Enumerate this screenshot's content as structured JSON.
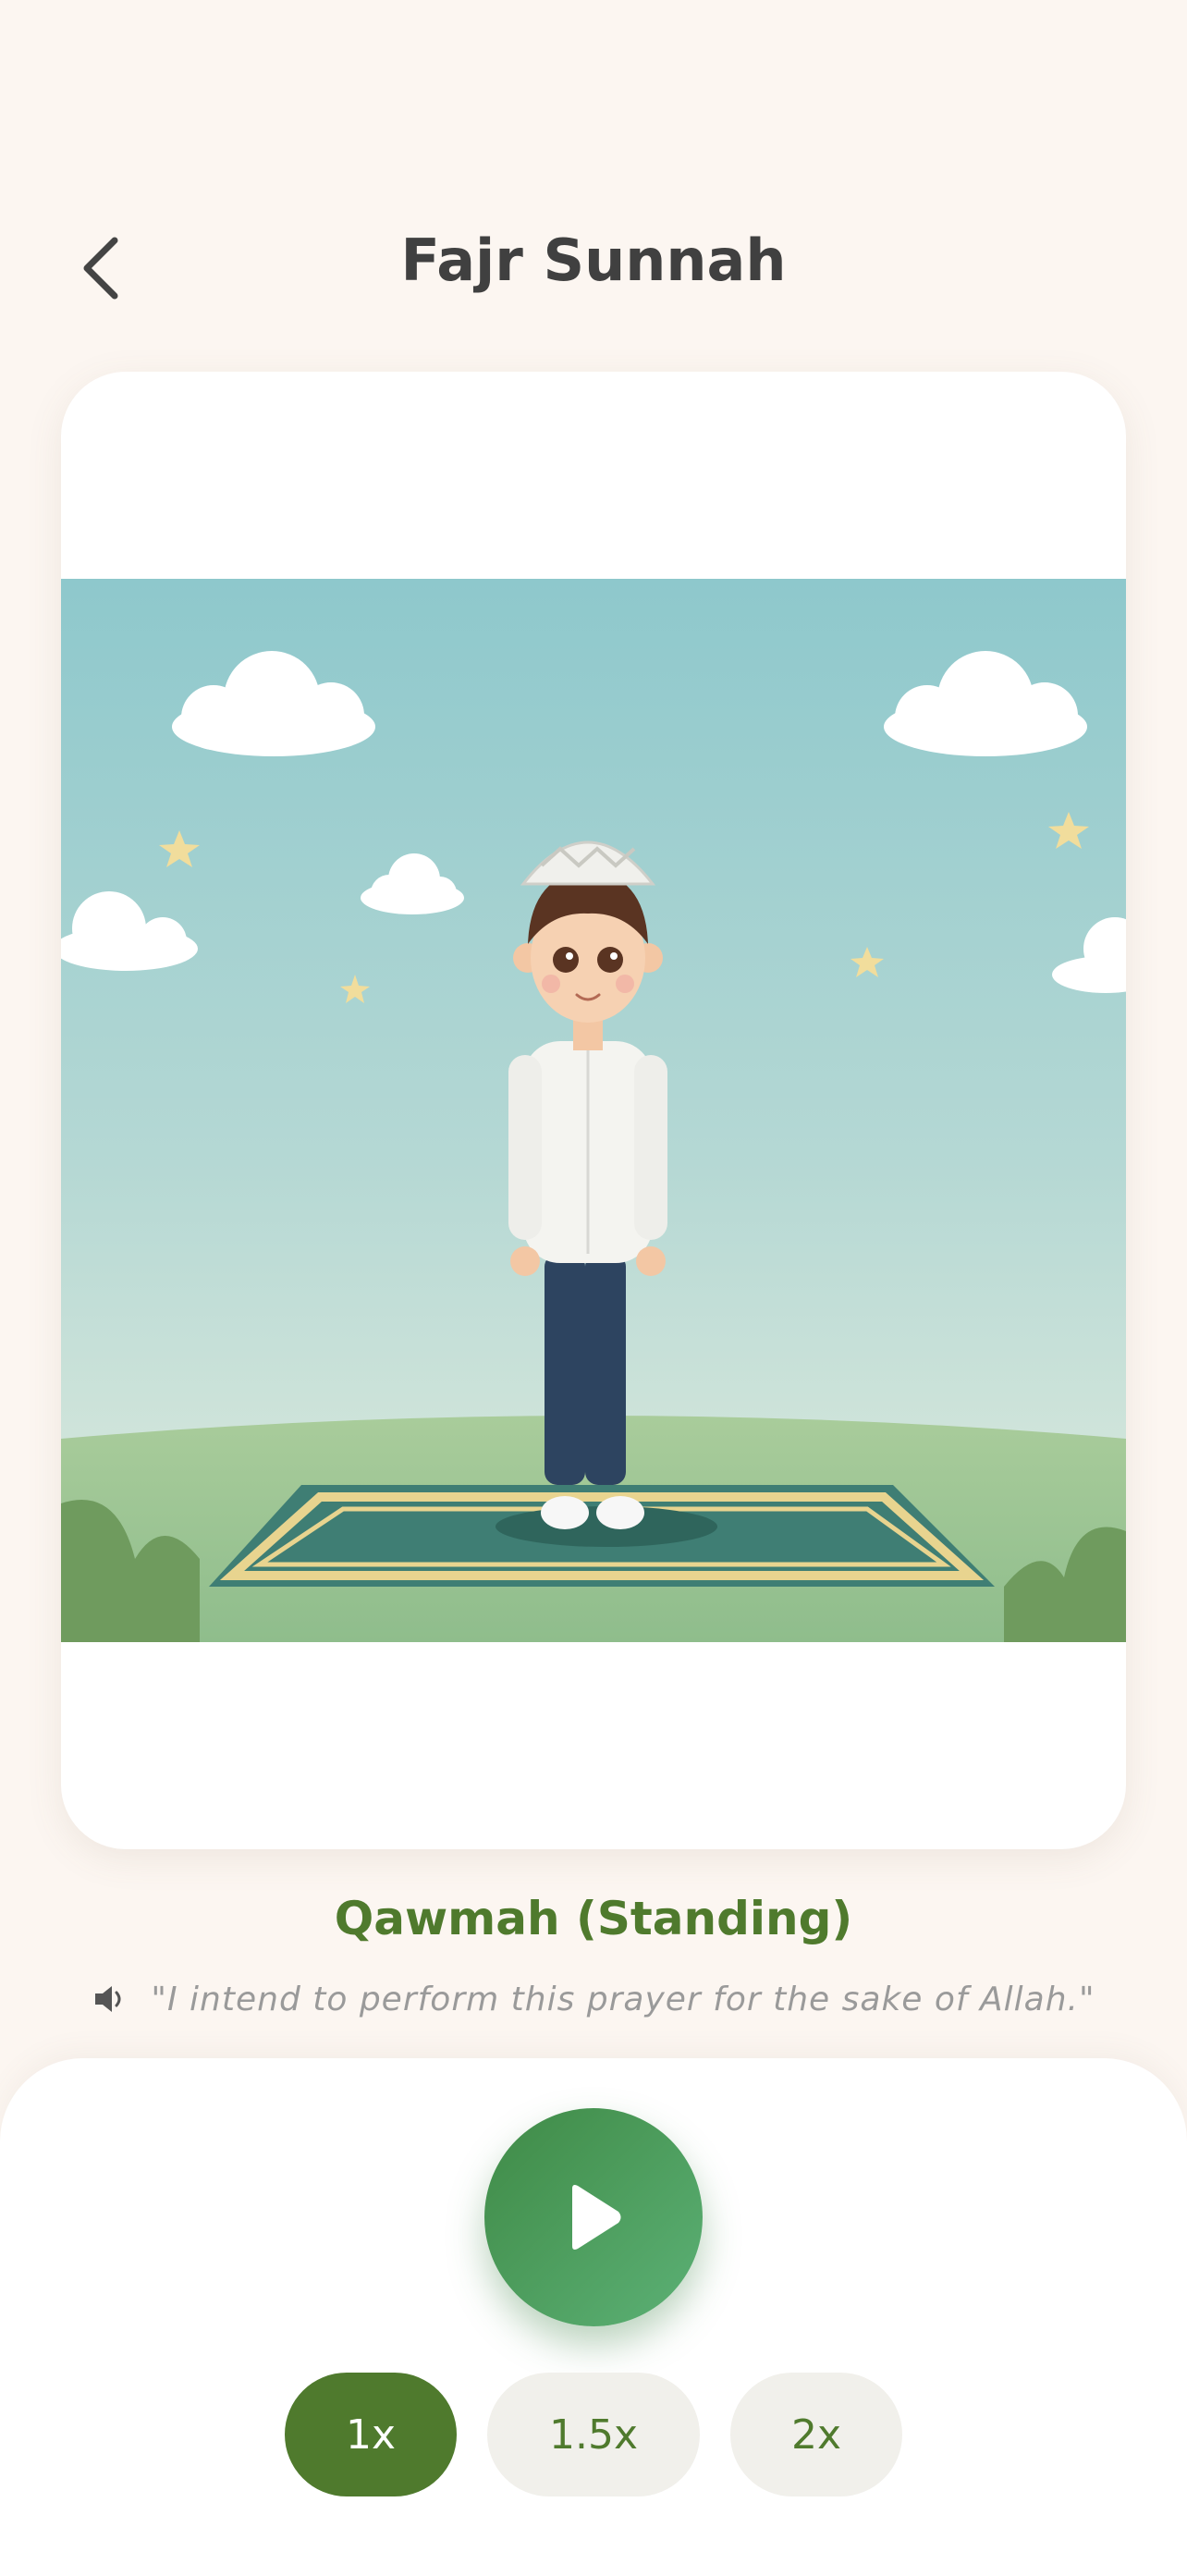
{
  "header": {
    "title": "Fajr Sunnah",
    "back_icon": "chevron-left-icon"
  },
  "step": {
    "name": "Qawmah (Standing)",
    "recitation_icon": "speaker-icon",
    "recitation": "\"I intend to perform this prayer for the sake of Allah.\""
  },
  "player": {
    "play_icon": "play-icon",
    "speeds": [
      "1x",
      "1.5x",
      "2x"
    ],
    "selected_speed": "1x"
  },
  "colors": {
    "accent": "#4f7a2d",
    "play_start": "#3f8a46",
    "play_end": "#5cb176",
    "background": "#fcf6f1"
  }
}
